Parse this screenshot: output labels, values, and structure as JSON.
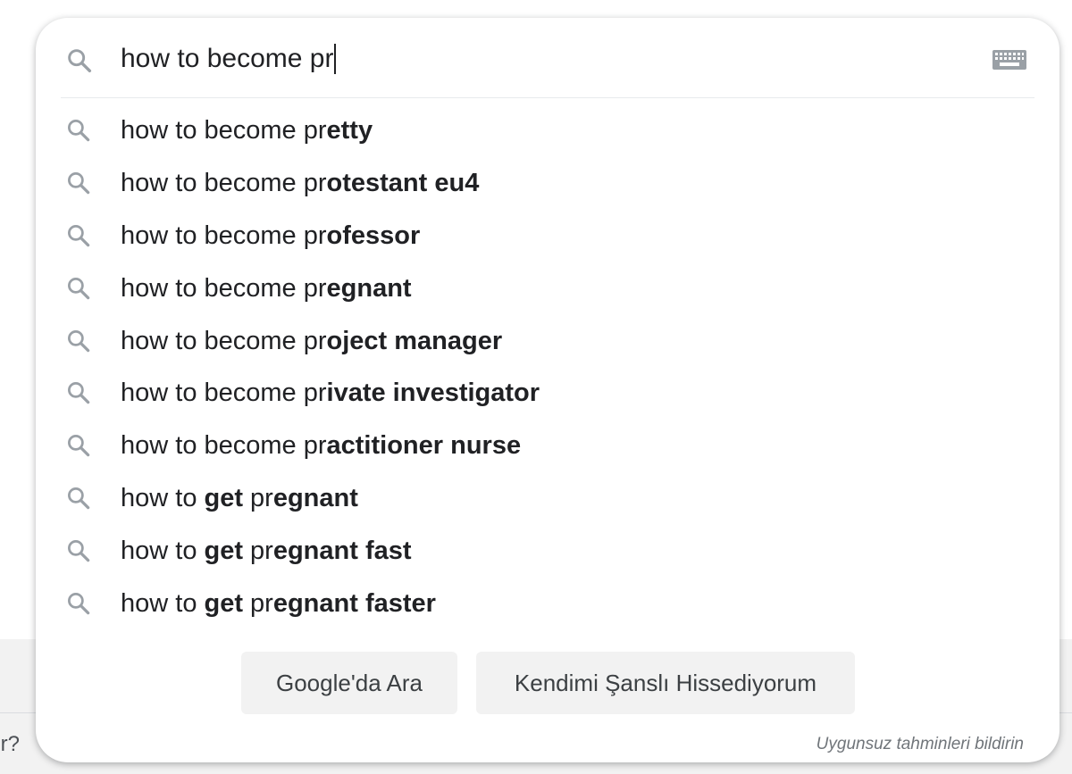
{
  "background": {
    "partial_text": "ır?"
  },
  "search": {
    "query": "how to become pr",
    "icon": "search-icon",
    "keyboard_icon": "keyboard-icon"
  },
  "suggestions": [
    {
      "normal_prefix": "how to become pr",
      "bold": "etty",
      "rest": ""
    },
    {
      "normal_prefix": "how to become pr",
      "bold": "otestant eu4",
      "rest": ""
    },
    {
      "normal_prefix": "how to become pr",
      "bold": "ofessor",
      "rest": ""
    },
    {
      "normal_prefix": "how to become pr",
      "bold": "egnant",
      "rest": ""
    },
    {
      "normal_prefix": "how to become pr",
      "bold": "oject manager",
      "rest": ""
    },
    {
      "normal_prefix": "how to become pr",
      "bold": "ivate investigator",
      "rest": ""
    },
    {
      "normal_prefix": "how to become pr",
      "bold": "actitioner nurse",
      "rest": ""
    },
    {
      "parts": [
        [
          "how to ",
          false
        ],
        [
          "get",
          true
        ],
        [
          " pr",
          false
        ],
        [
          "egnant",
          true
        ]
      ]
    },
    {
      "parts": [
        [
          "how to ",
          false
        ],
        [
          "get",
          true
        ],
        [
          " pr",
          false
        ],
        [
          "egnant fast",
          true
        ]
      ]
    },
    {
      "parts": [
        [
          "how to ",
          false
        ],
        [
          "get",
          true
        ],
        [
          " pr",
          false
        ],
        [
          "egnant faster",
          true
        ]
      ]
    }
  ],
  "buttons": {
    "search_label": "Google'da Ara",
    "lucky_label": "Kendimi Şanslı Hissediyorum"
  },
  "report_link": "Uygunsuz tahminleri bildirin",
  "colors": {
    "text": "#202124",
    "icon": "#9aa0a6",
    "button_bg": "#f2f2f2",
    "muted": "#70757a"
  }
}
